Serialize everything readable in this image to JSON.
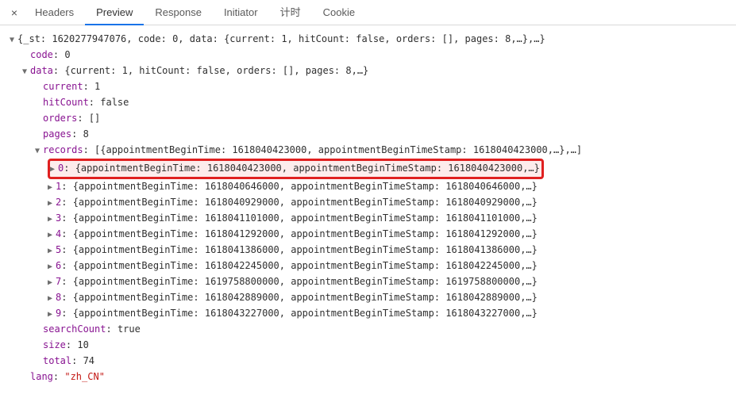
{
  "tabs": {
    "close": "×",
    "headers": "Headers",
    "preview": "Preview",
    "response": "Response",
    "initiator": "Initiator",
    "timing": "计时",
    "cookie": "Cookie"
  },
  "toggle": {
    "open": "▼",
    "closed": "▶"
  },
  "root_summary": "{_st: 1620277947076, code: 0, data: {current: 1, hitCount: false, orders: [], pages: 8,…},…}",
  "code": {
    "k": "code",
    "v": "0"
  },
  "data_summary": {
    "k": "data",
    "v": "{current: 1, hitCount: false, orders: [], pages: 8,…}"
  },
  "current": {
    "k": "current",
    "v": "1"
  },
  "hitCount": {
    "k": "hitCount",
    "v": "false"
  },
  "orders": {
    "k": "orders",
    "v": "[]"
  },
  "pages": {
    "k": "pages",
    "v": "8"
  },
  "records_summary": {
    "k": "records",
    "v": "[{appointmentBeginTime: 1618040423000, appointmentBeginTimeStamp: 1618040423000,…},…]"
  },
  "records": [
    {
      "idx": "0",
      "summary": "{appointmentBeginTime: 1618040423000, appointmentBeginTimeStamp: 1618040423000,…}"
    },
    {
      "idx": "1",
      "summary": "{appointmentBeginTime: 1618040646000, appointmentBeginTimeStamp: 1618040646000,…}"
    },
    {
      "idx": "2",
      "summary": "{appointmentBeginTime: 1618040929000, appointmentBeginTimeStamp: 1618040929000,…}"
    },
    {
      "idx": "3",
      "summary": "{appointmentBeginTime: 1618041101000, appointmentBeginTimeStamp: 1618041101000,…}"
    },
    {
      "idx": "4",
      "summary": "{appointmentBeginTime: 1618041292000, appointmentBeginTimeStamp: 1618041292000,…}"
    },
    {
      "idx": "5",
      "summary": "{appointmentBeginTime: 1618041386000, appointmentBeginTimeStamp: 1618041386000,…}"
    },
    {
      "idx": "6",
      "summary": "{appointmentBeginTime: 1618042245000, appointmentBeginTimeStamp: 1618042245000,…}"
    },
    {
      "idx": "7",
      "summary": "{appointmentBeginTime: 1619758800000, appointmentBeginTimeStamp: 1619758800000,…}"
    },
    {
      "idx": "8",
      "summary": "{appointmentBeginTime: 1618042889000, appointmentBeginTimeStamp: 1618042889000,…}"
    },
    {
      "idx": "9",
      "summary": "{appointmentBeginTime: 1618043227000, appointmentBeginTimeStamp: 1618043227000,…}"
    }
  ],
  "searchCount": {
    "k": "searchCount",
    "v": "true"
  },
  "size": {
    "k": "size",
    "v": "10"
  },
  "total": {
    "k": "total",
    "v": "74"
  },
  "lang": {
    "k": "lang",
    "v": "\"zh_CN\""
  }
}
